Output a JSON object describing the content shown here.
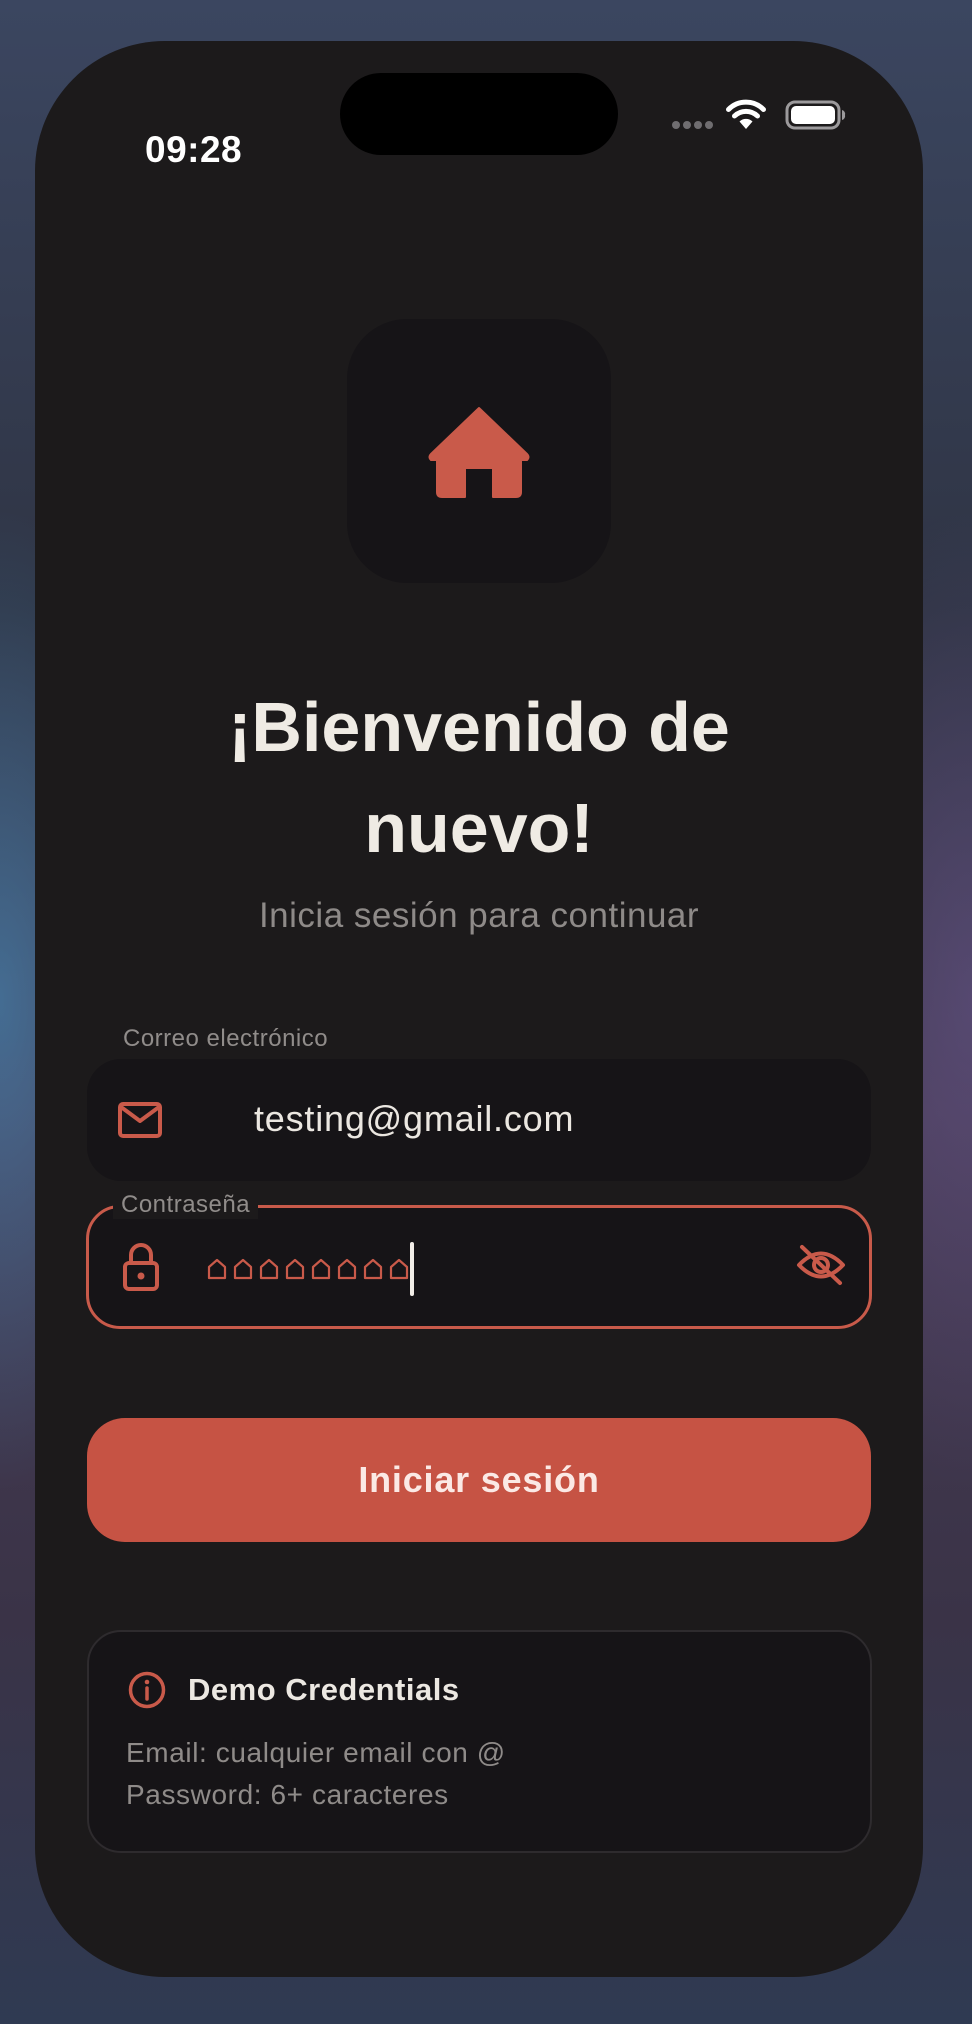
{
  "status_bar": {
    "time": "09:28",
    "icons": [
      "cellular-signal-icon",
      "wifi-icon",
      "battery-icon"
    ]
  },
  "logo": {
    "icon": "home-icon"
  },
  "header": {
    "title_line1": "¡Bienvenido de",
    "title_line2": "nuevo!",
    "subtitle": "Inicia sesión para continuar"
  },
  "email": {
    "label": "Correo electrónico",
    "value": "testing@gmail.com",
    "icon": "mail-icon"
  },
  "password": {
    "label": "Contraseña",
    "masked_char_count": 8,
    "icon": "lock-icon",
    "toggle_icon": "eye-off-icon"
  },
  "login_button": {
    "label": "Iniciar sesión"
  },
  "demo": {
    "title": "Demo Credentials",
    "line1": "Email: cualquier email con @",
    "line2": "Password: 6+ caracteres",
    "icon": "info-icon"
  },
  "colors": {
    "accent": "#c65344",
    "background": "#1c1a1b",
    "field_background": "#161417",
    "text_primary": "#efebe4",
    "text_secondary": "#8e8a88"
  }
}
